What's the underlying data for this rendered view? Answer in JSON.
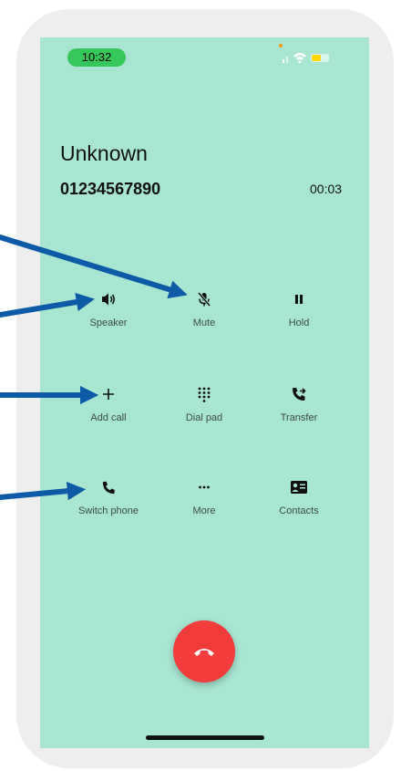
{
  "status_bar": {
    "time": "10:32"
  },
  "call": {
    "name": "Unknown",
    "number": "01234567890",
    "duration": "00:03"
  },
  "actions": {
    "speaker": "Speaker",
    "mute": "Mute",
    "hold": "Hold",
    "add_call": "Add call",
    "dial_pad": "Dial pad",
    "transfer": "Transfer",
    "switch_phone": "Switch phone",
    "more": "More",
    "contacts": "Contacts"
  },
  "icons": {
    "speaker": "speaker-icon",
    "mute": "mic-off-icon",
    "hold": "pause-icon",
    "add_call": "plus-icon",
    "dial_pad": "dialpad-icon",
    "transfer": "call-transfer-icon",
    "switch_phone": "phone-icon",
    "more": "more-dots-icon",
    "contacts": "contact-card-icon",
    "end_call": "end-call-icon"
  },
  "colors": {
    "screen_bg": "#a8e6d2",
    "time_pill": "#35c759",
    "end_call": "#f23b3b",
    "annotation_arrow": "#0d5aa7"
  }
}
